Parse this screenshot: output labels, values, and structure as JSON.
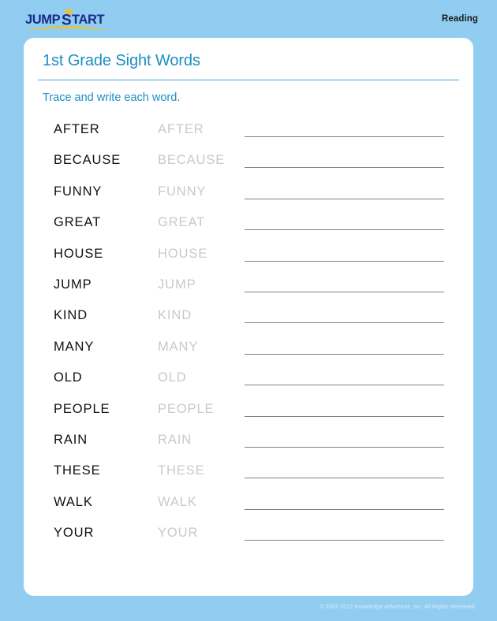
{
  "header": {
    "logo": {
      "name": "jumpstart-logo",
      "text_part1": "JUMP",
      "text_part2": "START",
      "text_full": "JUMPSTART",
      "text_color": "#1b2a8a",
      "accent_color": "#f2c21c"
    },
    "subject_label": "Reading"
  },
  "worksheet": {
    "title": "1st Grade Sight Words",
    "instruction": "Trace and write each word.",
    "title_color": "#1b8ec4",
    "divider_color": "#4aa8da",
    "rows": [
      {
        "word": "AFTER",
        "trace": "AFTER"
      },
      {
        "word": "BECAUSE",
        "trace": "BECAUSE"
      },
      {
        "word": "FUNNY",
        "trace": "FUNNY"
      },
      {
        "word": "GREAT",
        "trace": "GREAT"
      },
      {
        "word": "HOUSE",
        "trace": "HOUSE"
      },
      {
        "word": "JUMP",
        "trace": "JUMP"
      },
      {
        "word": "KIND",
        "trace": "KIND"
      },
      {
        "word": "MANY",
        "trace": "MANY"
      },
      {
        "word": "OLD",
        "trace": "OLD"
      },
      {
        "word": "PEOPLE",
        "trace": "PEOPLE"
      },
      {
        "word": "RAIN",
        "trace": "RAIN"
      },
      {
        "word": "THESE",
        "trace": "THESE"
      },
      {
        "word": "WALK",
        "trace": "WALK"
      },
      {
        "word": "YOUR",
        "trace": "YOUR"
      }
    ]
  },
  "footer": {
    "copyright": "© 2007-2012 Knowledge Adventure, Inc. All Rights Reserved."
  },
  "colors": {
    "page_background": "#90cdf0",
    "card_background": "#ffffff",
    "write_line": "#828282",
    "trace_text": "#c9c9c9",
    "solid_text": "#111111"
  }
}
